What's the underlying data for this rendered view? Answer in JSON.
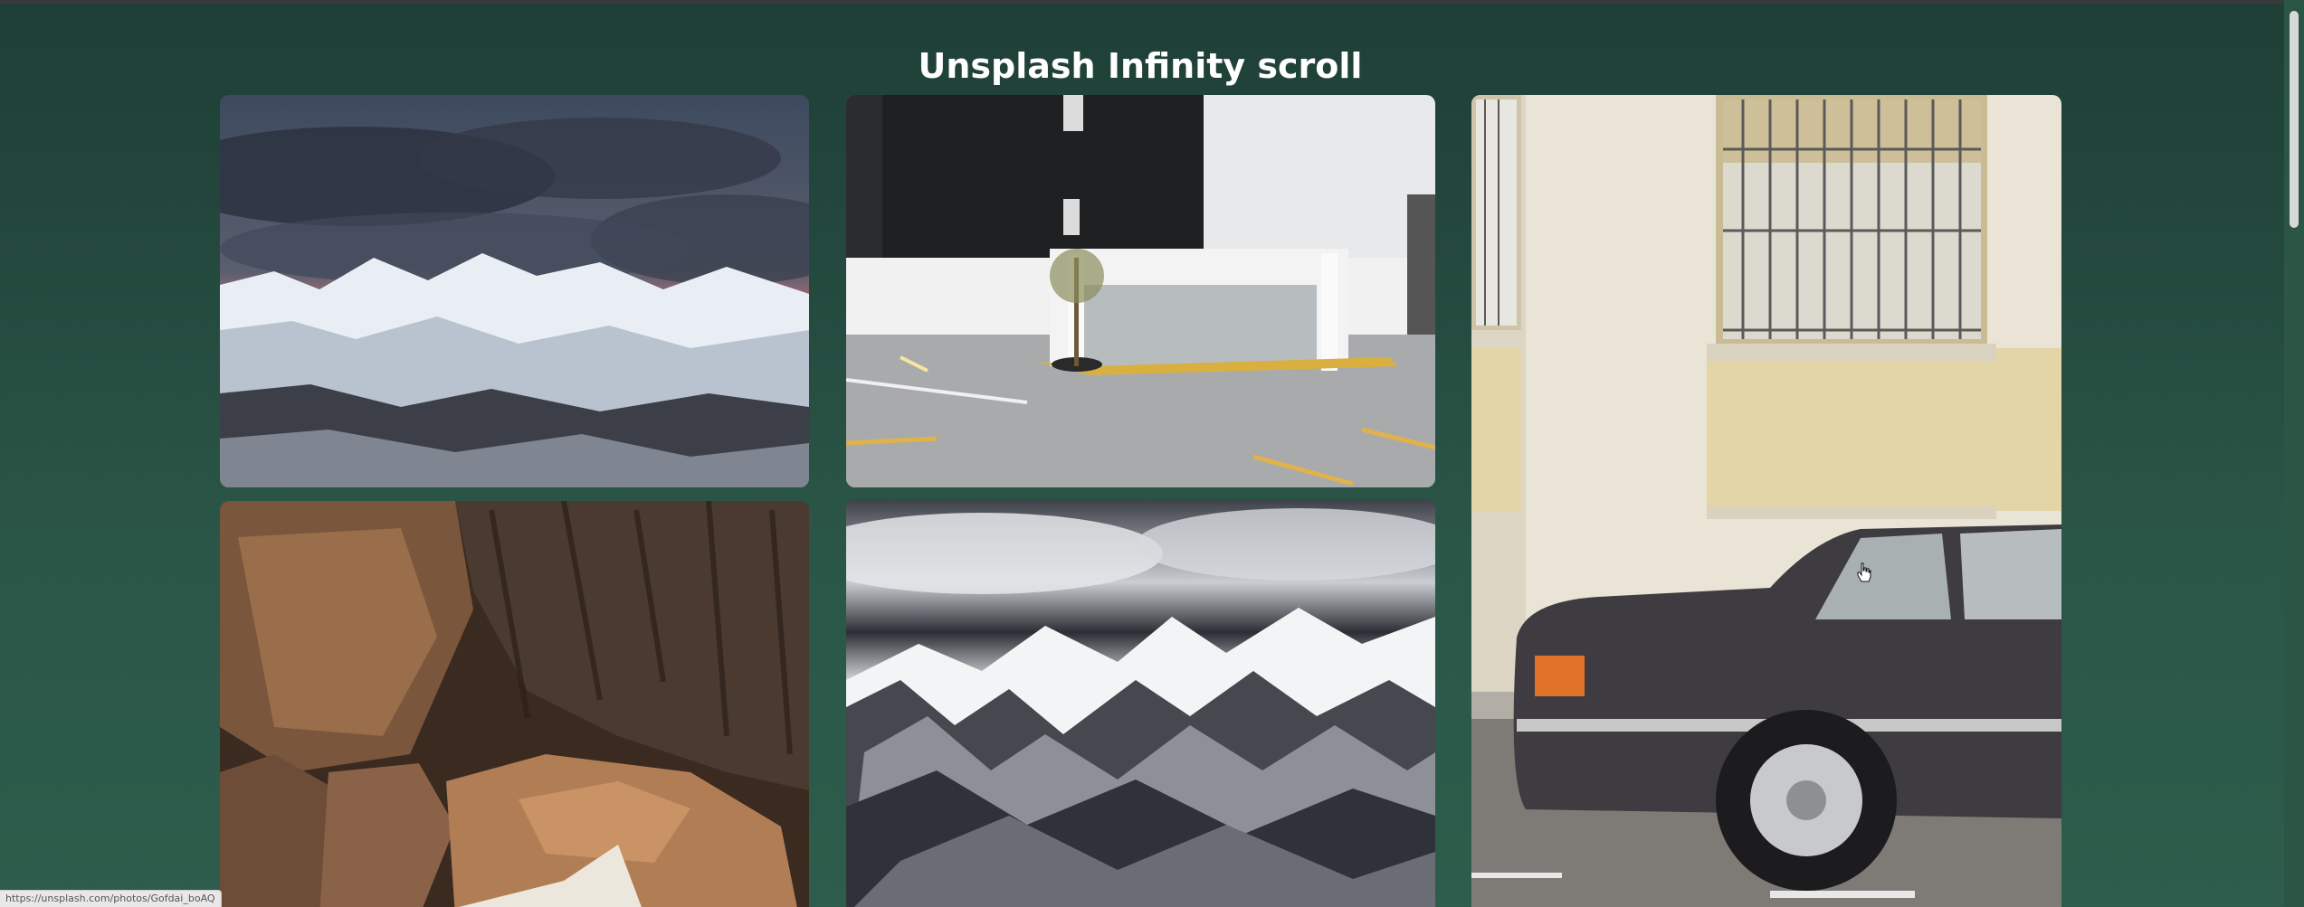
{
  "page": {
    "title": "Unsplash Infinity scroll",
    "status_url": "https://unsplash.com/photos/Gofdai_boAQ"
  },
  "photos": [
    {
      "id": "p1",
      "description": "snowy mountains under pink sunset clouds"
    },
    {
      "id": "p2",
      "description": "modern building with glass pavilion and parking lot"
    },
    {
      "id": "p3",
      "description": "vintage dark sedan parked beside cream building with barred window"
    },
    {
      "id": "p4",
      "description": "rocks and tree bark with envelope"
    },
    {
      "id": "p5",
      "description": "dramatic snow-covered rocky mountain peaks"
    }
  ],
  "colors": {
    "background_top": "#1e3f36",
    "background_bottom": "#2e5d4c",
    "title": "#ffffff"
  }
}
